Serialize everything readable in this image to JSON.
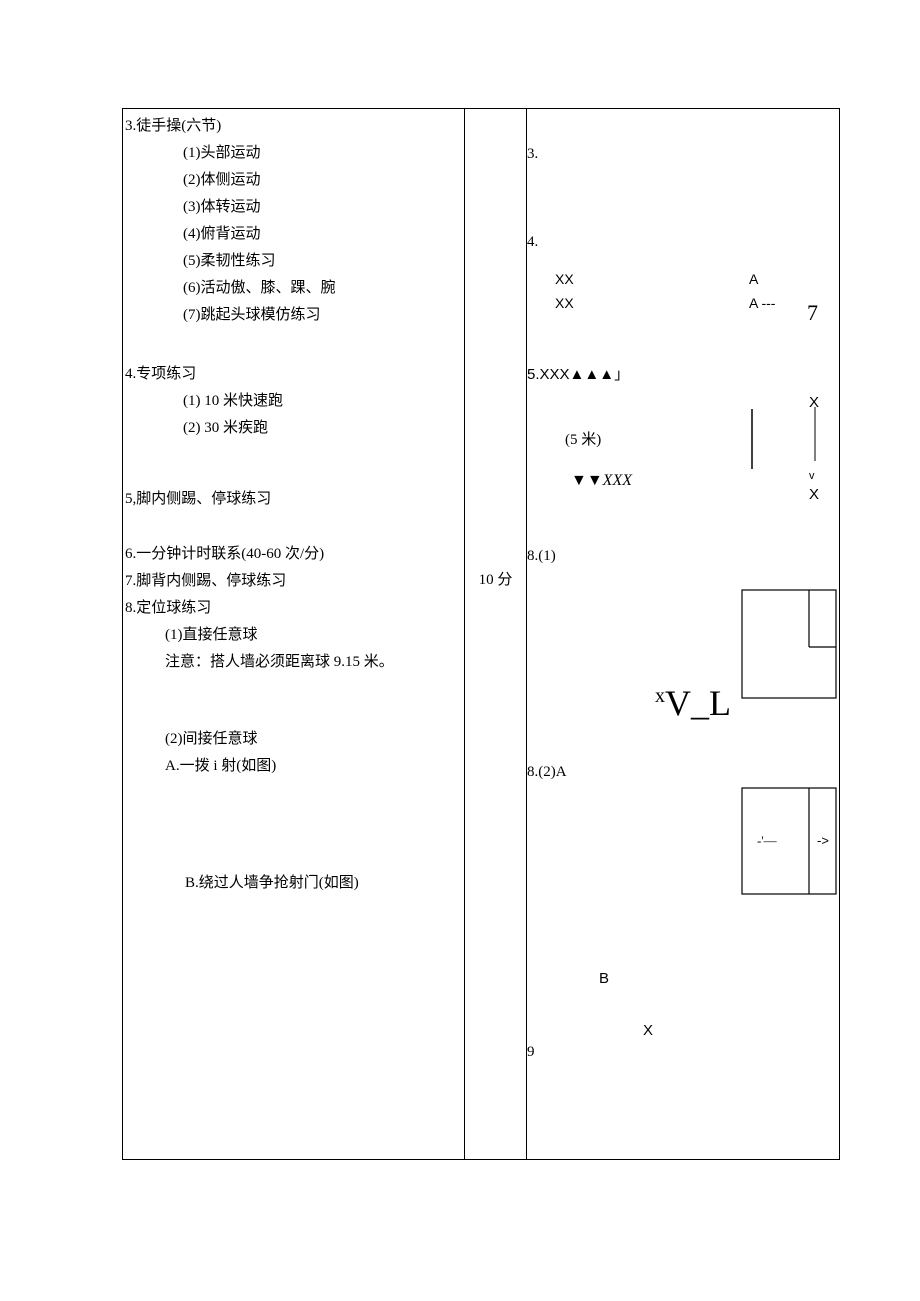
{
  "left": {
    "section3": {
      "title": "3.徒手操(六节)",
      "items": [
        "(1)头部运动",
        "(2)体侧运动",
        "(3)体转运动",
        "(4)俯背运动",
        "(5)柔韧性练习",
        "(6)活动傲、膝、踝、腕",
        "(7)跳起头球模仿练习"
      ]
    },
    "section4": {
      "title": "4.专项练习",
      "items": [
        "(1)   10 米快速跑",
        "(2)   30 米疾跑"
      ]
    },
    "section5": "5,脚内侧踢、停球练习",
    "section6": "6.一分钟计时联系(40-60 次/分)",
    "section7": "7.脚背内侧踢、停球练习",
    "section8": {
      "title": "8.定位球练习",
      "sub1": "(1)直接任意球",
      "note": "注意：搭人墙必须距离球 9.15 米。",
      "sub2": "(2)间接任意球",
      "a": "A.一拨 i 射(如图)",
      "b": "B.绕过人墙争抢射门(如图)"
    }
  },
  "mid": {
    "time": "10 分"
  },
  "right": {
    "n3": "3.",
    "n4": "4.",
    "row1a": "XX",
    "row1b": "A",
    "row2a": "XX",
    "row2b": "A ---",
    "num7": "7",
    "n5": "5.XXX▲▲▲」",
    "x_top": "X",
    "dist": "(5 米)",
    "triangles": "▼▼",
    "xxx_it": "XXX",
    "v_sm": "v",
    "x_bot": "X",
    "n81": "8.(1)",
    "xvl_sup": "x",
    "xvl": "V_L",
    "n82a": "8.(2)A",
    "dash_l": "-'—",
    "arrow_r": "->",
    "B": "B",
    "X": "X",
    "n9": "9"
  }
}
